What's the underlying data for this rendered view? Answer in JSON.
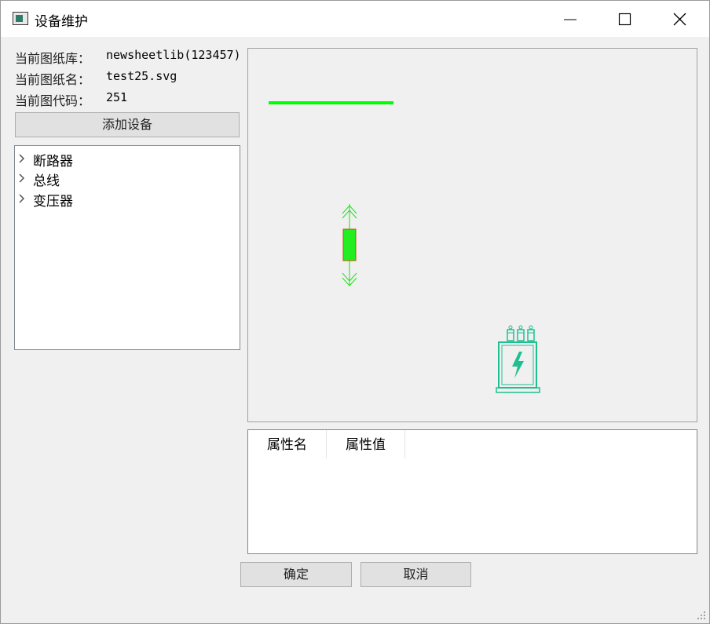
{
  "window": {
    "title": "设备维护"
  },
  "info": {
    "library_label": "当前图纸库：",
    "library_value": "newsheetlib(123457)",
    "sheet_label": "当前图纸名：",
    "sheet_value": "test25.svg",
    "code_label": "当前图代码：",
    "code_value": "251"
  },
  "add_button": "添加设备",
  "tree": {
    "items": [
      {
        "label": "断路器"
      },
      {
        "label": "总线"
      },
      {
        "label": "变压器"
      }
    ]
  },
  "properties": {
    "columns": [
      "属性名",
      "属性值"
    ]
  },
  "footer": {
    "ok": "确定",
    "cancel": "取消"
  },
  "colors": {
    "bus": "#00ff00",
    "breaker_fill": "#22ee22",
    "breaker_border": "#b25a00",
    "transformer": "#1fbf8f"
  }
}
